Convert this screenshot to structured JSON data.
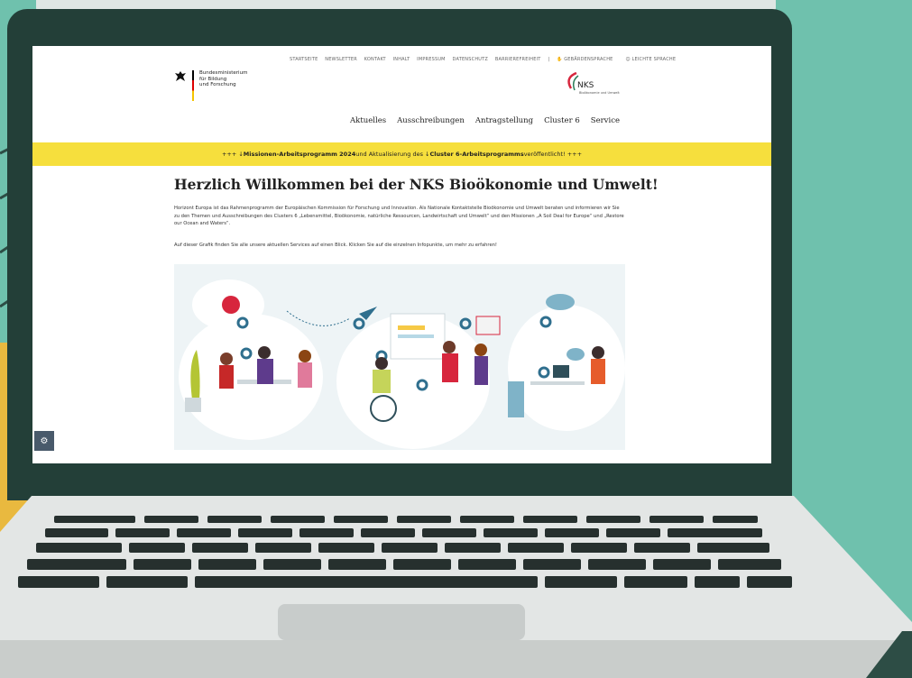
{
  "utility_nav": [
    "STARTSEITE",
    "NEWSLETTER",
    "KONTAKT",
    "INHALT",
    "IMPRESSUM",
    "DATENSCHUTZ",
    "BARRIEREFREIHEIT",
    "|",
    "GEBÄRDENSPRACHE",
    "LEICHTE SPRACHE"
  ],
  "ministry": {
    "line1": "Bundesministerium",
    "line2": "für Bildung",
    "line3": "und Forschung"
  },
  "nks_logo": {
    "name": "NKS",
    "subtitle": "Bioökonomie und Umwelt"
  },
  "main_nav": [
    "Aktuelles",
    "Ausschreibungen",
    "Antragstellung",
    "Cluster 6",
    "Service"
  ],
  "banner": {
    "prefix": "+++ ↓ ",
    "link1": "Missionen-Arbeitsprogramm 2024",
    "middle": " und Aktualisierung des ↓ ",
    "link2": "Cluster 6-Arbeitsprogramms",
    "suffix": " veröffentlicht! +++"
  },
  "headline": "Herzlich Willkommen bei der NKS Bioökonomie und Umwelt!",
  "intro": "Horizont Europa ist das Rahmenprogramm der Europäischen Kommission für Forschung und Innovation. Als Nationale Kontaktstelle Bioökonomie und Umwelt beraten und informieren wir Sie zu den Themen und Ausschreibungen des Clusters 6 „Lebensmittel, Bioökonomie, natürliche Ressourcen, Landwirtschaft und Umwelt“ und den Missionen „A Soil Deal for Europe“ und „Restore our Ocean and Waters“.",
  "grafik_note": "Auf dieser Grafik finden Sie alle unsere aktuellen Services auf einen Blick. Klicken Sie auf die einzelnen Infopunkte, um mehr zu erfahren!",
  "colors": {
    "banner": "#f6df3d",
    "bezel": "#233f38",
    "background": "#6fc1ad"
  }
}
